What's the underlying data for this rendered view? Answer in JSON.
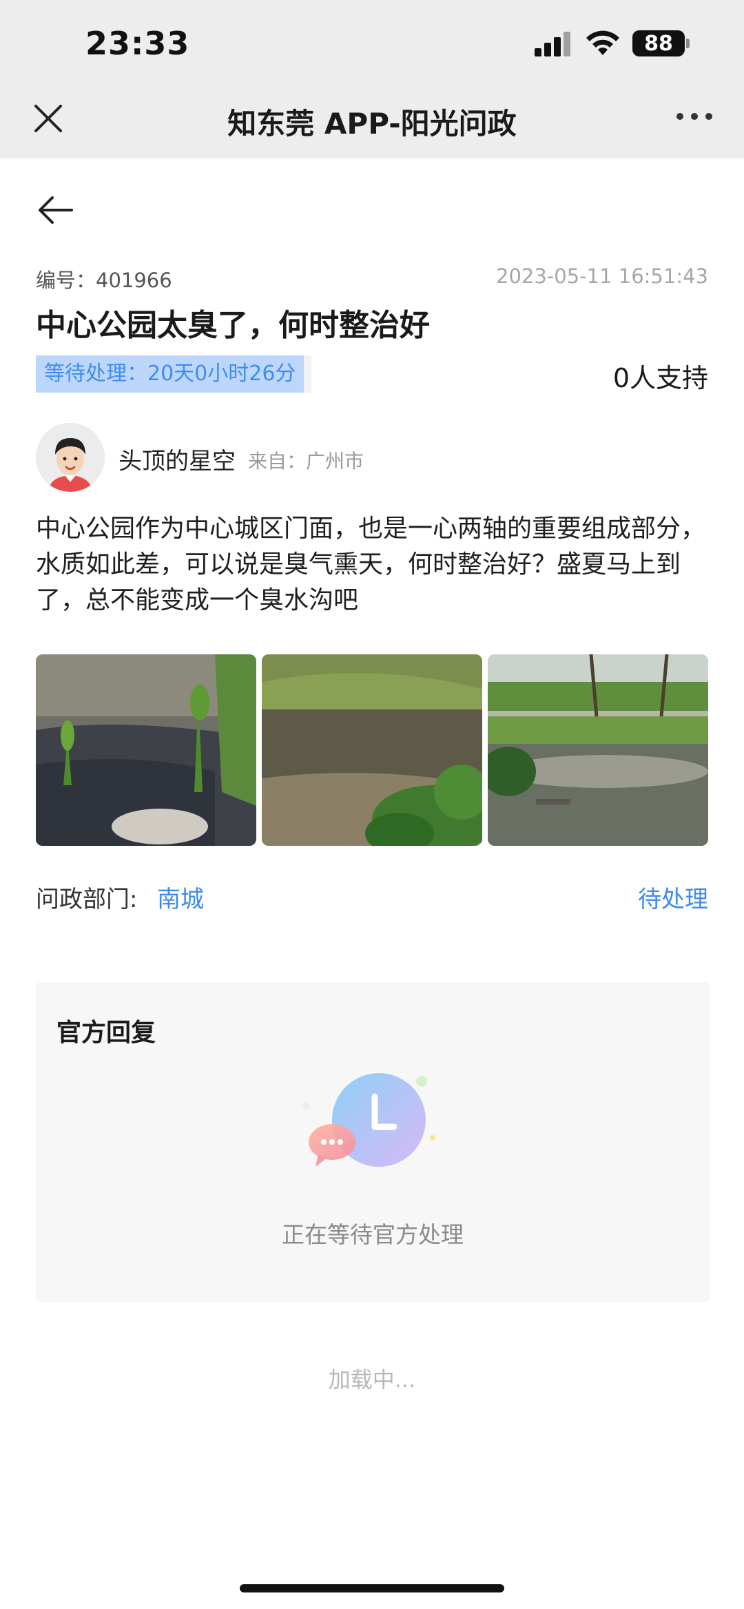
{
  "status_bar": {
    "time": "23:33",
    "battery": "88"
  },
  "nav": {
    "title": "知东莞 APP-阳光问政"
  },
  "post": {
    "serial": "编号：401966",
    "date": "2023-05-11 16:51:43",
    "title": "中心公园太臭了，何时整治好",
    "waiting": "等待处理：20天0小时26分",
    "support": "0人支持",
    "author": "头顶的星空",
    "from": "来自：广州市",
    "body": "中心公园作为中心城区门面，也是一心两轴的重要组成部分，水质如此差，可以说是臭气熏天，何时整治好？盛夏马上到了，总不能变成一个臭水沟吧",
    "dept_label": "问政部门:",
    "dept_value": "南城",
    "status": "待处理"
  },
  "reply": {
    "title": "官方回复",
    "status": "正在等待官方处理"
  },
  "footer": {
    "loading": "加载中..."
  }
}
